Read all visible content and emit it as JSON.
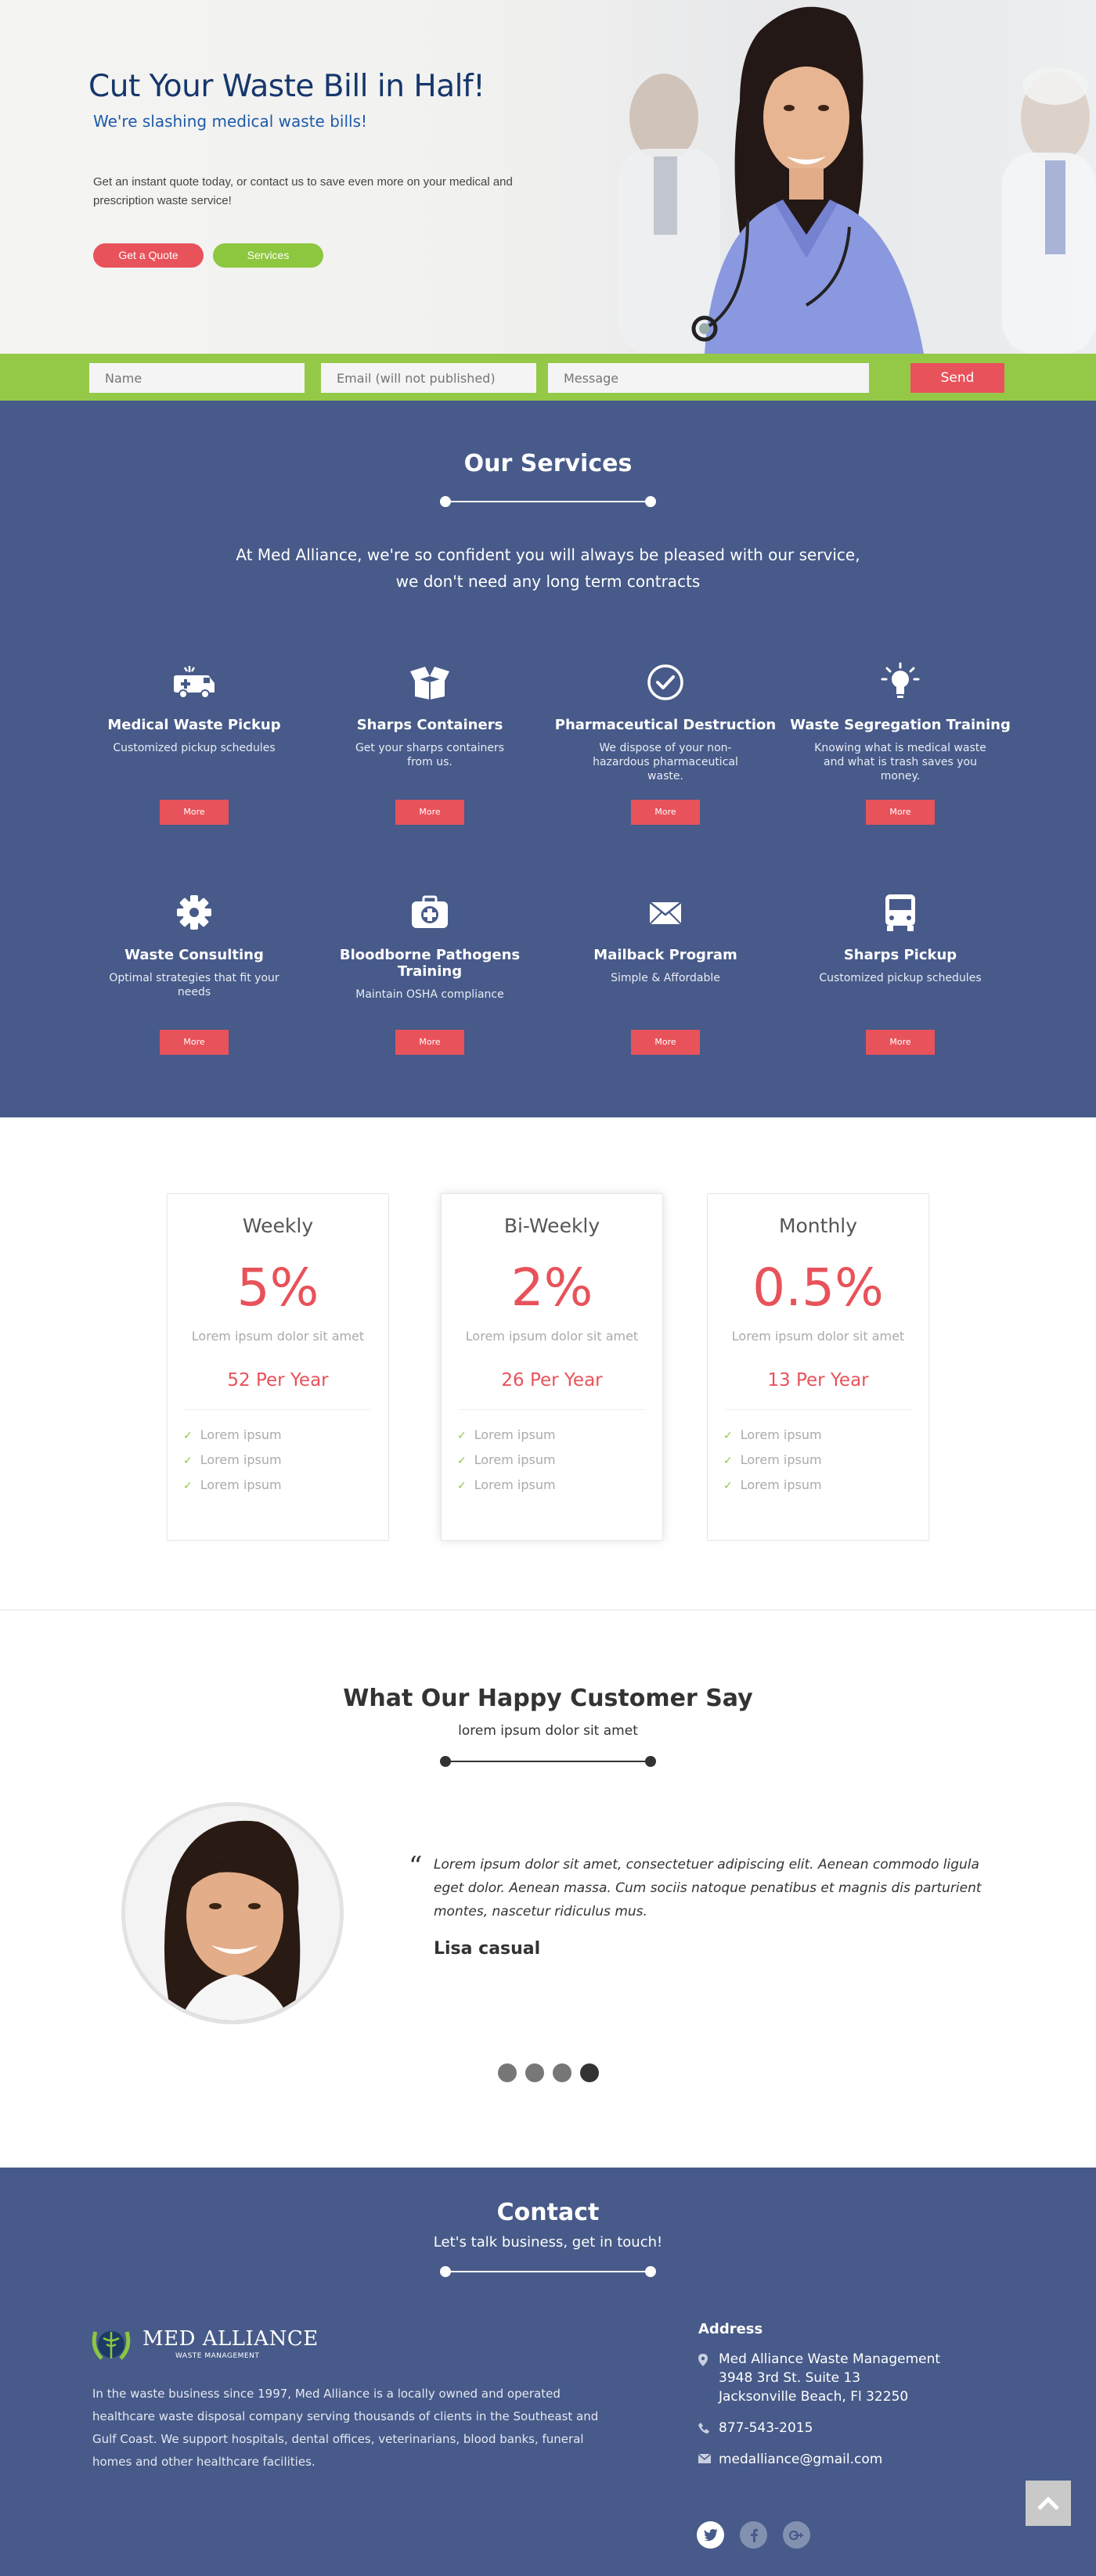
{
  "hero": {
    "title": "Cut Your Waste Bill in Half!",
    "subtitle": "We're slashing medical waste bills!",
    "body": "Get an instant quote today, or contact us to save even more on your medical and prescription waste service!",
    "quote_button": "Get a Quote",
    "services_button": "Services"
  },
  "form": {
    "name_placeholder": "Name",
    "email_placeholder": "Email (will not published)",
    "message_placeholder": "Message",
    "send_label": "Send"
  },
  "services": {
    "title": "Our Services",
    "intro_line1": "At Med Alliance, we're so confident you will always be pleased with our service,",
    "intro_line2": "we don't need any long term contracts",
    "more_label": "More",
    "items": [
      {
        "name": "Medical Waste Pickup",
        "desc": "Customized pickup schedules",
        "icon": "ambulance-icon"
      },
      {
        "name": "Sharps Containers",
        "desc": "Get your sharps containers from us.",
        "icon": "open-box-icon"
      },
      {
        "name": "Pharmaceutical Destruction",
        "desc": "We dispose of your non-hazardous pharmaceutical waste.",
        "icon": "check-circle-icon"
      },
      {
        "name": "Waste Segregation Training",
        "desc": "Knowing what is medical waste and what is trash saves you money.",
        "icon": "lightbulb-icon"
      },
      {
        "name": "Waste Consulting",
        "desc": "Optimal strategies that fit your needs",
        "icon": "gear-icon"
      },
      {
        "name": "Bloodborne Pathogens Training",
        "desc": "Maintain OSHA compliance",
        "icon": "medical-kit-icon"
      },
      {
        "name": "Mailback Program",
        "desc": "Simple & Affordable",
        "icon": "envelope-icon"
      },
      {
        "name": "Sharps Pickup",
        "desc": "Customized pickup schedules",
        "icon": "truck-icon"
      }
    ]
  },
  "pricing": {
    "plans": [
      {
        "name": "Weekly",
        "percent": "5%",
        "lorem": "Lorem ipsum dolor sit amet",
        "per": "52 Per Year",
        "features": [
          "Lorem ipsum",
          "Lorem ipsum",
          "Lorem ipsum"
        ]
      },
      {
        "name": "Bi-Weekly",
        "percent": "2%",
        "lorem": "Lorem ipsum dolor sit amet",
        "per": "26 Per Year",
        "features": [
          "Lorem ipsum",
          "Lorem ipsum",
          "Lorem ipsum"
        ]
      },
      {
        "name": "Monthly",
        "percent": "0.5%",
        "lorem": "Lorem ipsum dolor sit amet",
        "per": "13 Per Year",
        "features": [
          "Lorem ipsum",
          "Lorem ipsum",
          "Lorem ipsum"
        ]
      }
    ]
  },
  "testimonial": {
    "title": "What Our Happy Customer Say",
    "subtitle": "lorem ipsum dolor sit amet",
    "quote_mark": "“",
    "quote": "Lorem ipsum dolor sit amet, consectetuer adipiscing elit. Aenean commodo ligula eget dolor. Aenean massa. Cum sociis natoque penatibus et magnis dis parturient montes, nascetur ridiculus mus.",
    "author": "Lisa casual",
    "slide_count": 4,
    "active_slide": 4
  },
  "contact": {
    "title": "Contact",
    "subtitle": "Let's talk business, get in touch!",
    "logo_name": "MED ALLIANCE",
    "logo_sub": "WASTE MANAGEMENT",
    "about": "In the waste business since 1997, Med Alliance is a locally owned and operated healthcare waste disposal company serving thousands of clients in the Southeast and Gulf Coast. We support hospitals, dental offices, veterinarians, blood banks, funeral homes and other healthcare facilities.",
    "address_head": "Address",
    "address_line1": "Med Alliance Waste Management",
    "address_line2": "3948 3rd St. Suite 13",
    "address_line3": "Jacksonville Beach, Fl 32250",
    "phone": "877-543-2015",
    "email": "medalliance@gmail.com",
    "social": [
      "twitter-icon",
      "facebook-icon",
      "google-plus-icon"
    ]
  },
  "colors": {
    "navy": "#475a89",
    "green": "#94c948",
    "red": "#e8525a",
    "hero_title": "#16376b"
  }
}
